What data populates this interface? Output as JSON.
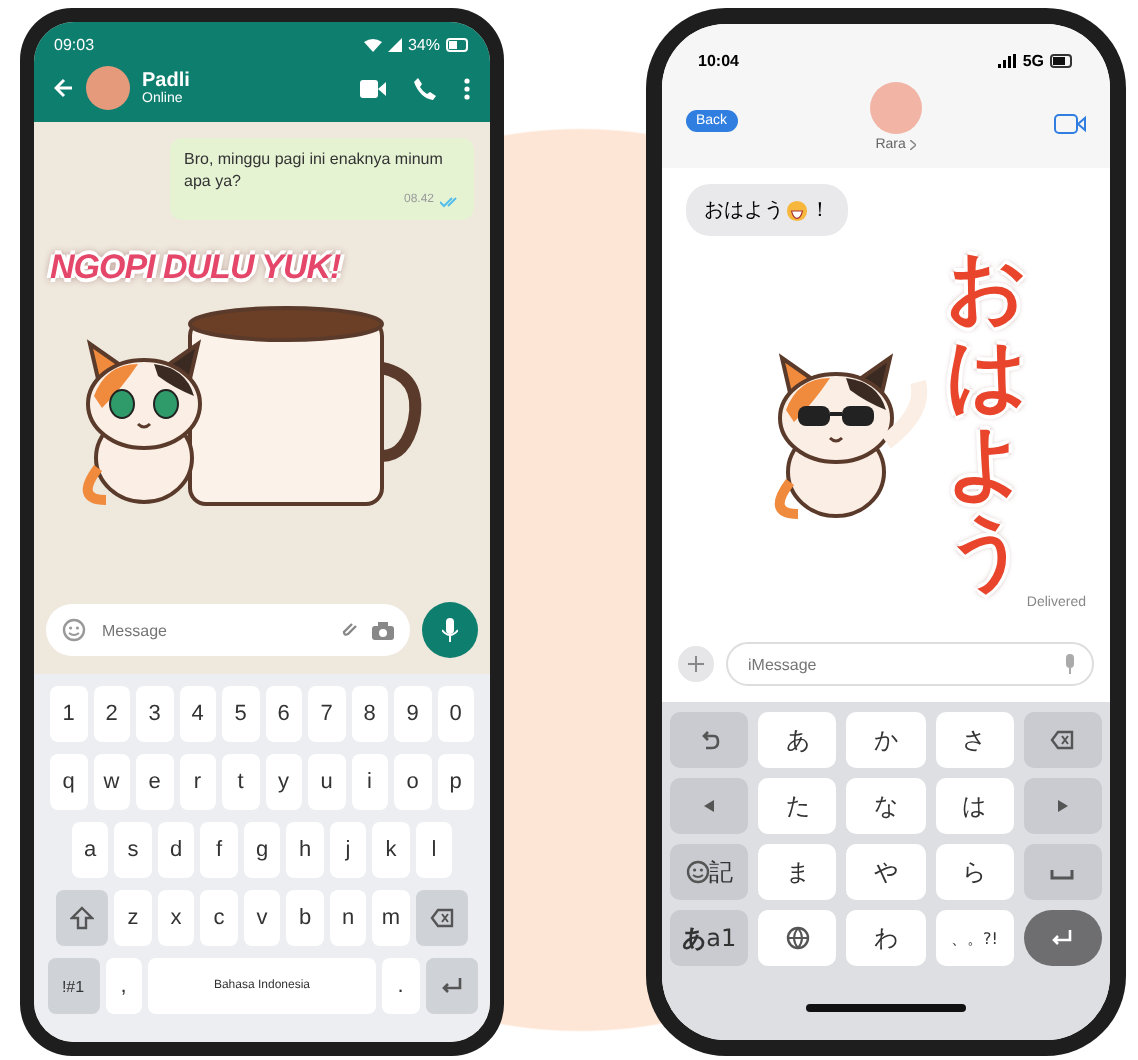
{
  "android_phone": {
    "status_bar": {
      "time": "09:03",
      "battery": "34%"
    },
    "header": {
      "name": "Padli",
      "status": "Online"
    },
    "message": {
      "text": "Bro, minggu pagi ini enaknya minum apa ya?",
      "time": "08.42",
      "read": true
    },
    "sticker": {
      "text": "NGOPI DULU YUK!"
    },
    "input": {
      "placeholder": "Message"
    },
    "keyboard": [
      [
        {
          "kind": "char",
          "label": "1"
        },
        {
          "kind": "char",
          "label": "2"
        },
        {
          "kind": "char",
          "label": "3"
        },
        {
          "kind": "char",
          "label": "4"
        },
        {
          "kind": "char",
          "label": "5"
        },
        {
          "kind": "char",
          "label": "6"
        },
        {
          "kind": "char",
          "label": "7"
        },
        {
          "kind": "char",
          "label": "8"
        },
        {
          "kind": "char",
          "label": "9"
        },
        {
          "kind": "char",
          "label": "0"
        }
      ],
      [
        {
          "kind": "char",
          "label": "q"
        },
        {
          "kind": "char",
          "label": "w"
        },
        {
          "kind": "char",
          "label": "e"
        },
        {
          "kind": "char",
          "label": "r"
        },
        {
          "kind": "char",
          "label": "t"
        },
        {
          "kind": "char",
          "label": "y"
        },
        {
          "kind": "char",
          "label": "u"
        },
        {
          "kind": "char",
          "label": "i"
        },
        {
          "kind": "char",
          "label": "o"
        },
        {
          "kind": "char",
          "label": "p"
        }
      ],
      [
        {
          "kind": "char",
          "label": "a"
        },
        {
          "kind": "char",
          "label": "s"
        },
        {
          "kind": "char",
          "label": "d"
        },
        {
          "kind": "char",
          "label": "f"
        },
        {
          "kind": "char",
          "label": "g"
        },
        {
          "kind": "char",
          "label": "h"
        },
        {
          "kind": "char",
          "label": "j"
        },
        {
          "kind": "char",
          "label": "k"
        },
        {
          "kind": "char",
          "label": "l"
        }
      ],
      [
        {
          "kind": "shift"
        },
        {
          "kind": "char",
          "label": "z"
        },
        {
          "kind": "char",
          "label": "x"
        },
        {
          "kind": "char",
          "label": "c"
        },
        {
          "kind": "char",
          "label": "v"
        },
        {
          "kind": "char",
          "label": "b"
        },
        {
          "kind": "char",
          "label": "n"
        },
        {
          "kind": "char",
          "label": "m"
        },
        {
          "kind": "delete"
        }
      ],
      [
        {
          "kind": "mode",
          "label": "!#1"
        },
        {
          "kind": "char",
          "label": ","
        },
        {
          "kind": "space",
          "label": "Bahasa Indonesia"
        },
        {
          "kind": "char",
          "label": "."
        },
        {
          "kind": "return"
        }
      ]
    ]
  },
  "iphone": {
    "status_bar": {
      "time": "10:04",
      "network": "5G"
    },
    "header": {
      "back": "Back",
      "name": "Rara"
    },
    "message": {
      "text_before": "おはよう",
      "text_after": "！"
    },
    "sticker": {
      "text": "おはよう"
    },
    "delivery": "Delivered",
    "input": {
      "placeholder": "iMessage"
    },
    "keyboard": [
      [
        {
          "kind": "undo"
        },
        {
          "kind": "char",
          "label": "あ"
        },
        {
          "kind": "char",
          "label": "か"
        },
        {
          "kind": "char",
          "label": "さ"
        },
        {
          "kind": "delete"
        }
      ],
      [
        {
          "kind": "left"
        },
        {
          "kind": "char",
          "label": "た"
        },
        {
          "kind": "char",
          "label": "な"
        },
        {
          "kind": "char",
          "label": "は"
        },
        {
          "kind": "right"
        }
      ],
      [
        {
          "kind": "emoji",
          "label": "記"
        },
        {
          "kind": "char",
          "label": "ま"
        },
        {
          "kind": "char",
          "label": "や"
        },
        {
          "kind": "char",
          "label": "ら"
        },
        {
          "kind": "space"
        }
      ],
      [
        {
          "kind": "mode",
          "label": "**あ**a1"
        },
        {
          "kind": "globe"
        },
        {
          "kind": "char",
          "label": "わ"
        },
        {
          "kind": "char",
          "label": "、。?!"
        },
        {
          "kind": "return"
        }
      ]
    ]
  }
}
